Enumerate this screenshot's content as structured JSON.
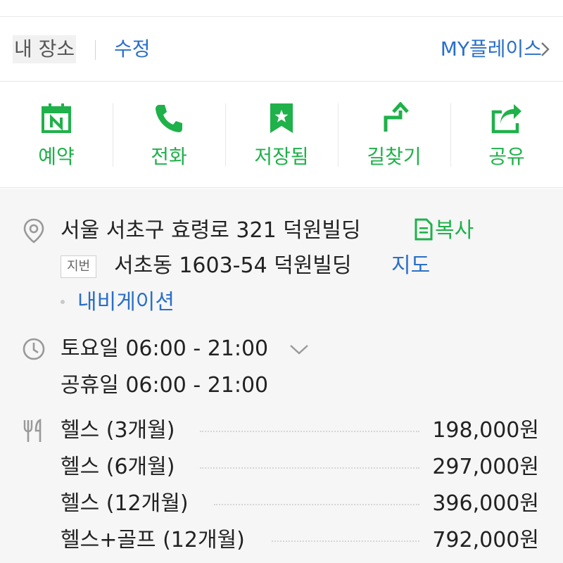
{
  "myplace": {
    "label": "내 장소",
    "edit": "수정",
    "link": "MY플레이스"
  },
  "actions": [
    {
      "label": "예약",
      "icon": "calendar-n-icon"
    },
    {
      "label": "전화",
      "icon": "phone-icon"
    },
    {
      "label": "저장됨",
      "icon": "bookmark-star-icon"
    },
    {
      "label": "길찾기",
      "icon": "directions-arrow-icon"
    },
    {
      "label": "공유",
      "icon": "share-icon"
    }
  ],
  "address": {
    "road": "서울 서초구 효령로 321 덕원빌딩",
    "copy": "복사",
    "jibun_badge": "지번",
    "jibun": "서초동 1603-54 덕원빌딩",
    "map": "지도",
    "navigation": "내비게이션"
  },
  "hours": {
    "today": "토요일 06:00 - 21:00",
    "holiday": "공휴일 06:00 - 21:00"
  },
  "menu": [
    {
      "name": "헬스 (3개월)",
      "price": "198,000원"
    },
    {
      "name": "헬스 (6개월)",
      "price": "297,000원"
    },
    {
      "name": "헬스 (12개월)",
      "price": "396,000원"
    },
    {
      "name": "헬스+골프 (12개월)",
      "price": "792,000원"
    }
  ],
  "colors": {
    "accent_green": "#1fb14a",
    "link_blue": "#2a6fc9"
  }
}
